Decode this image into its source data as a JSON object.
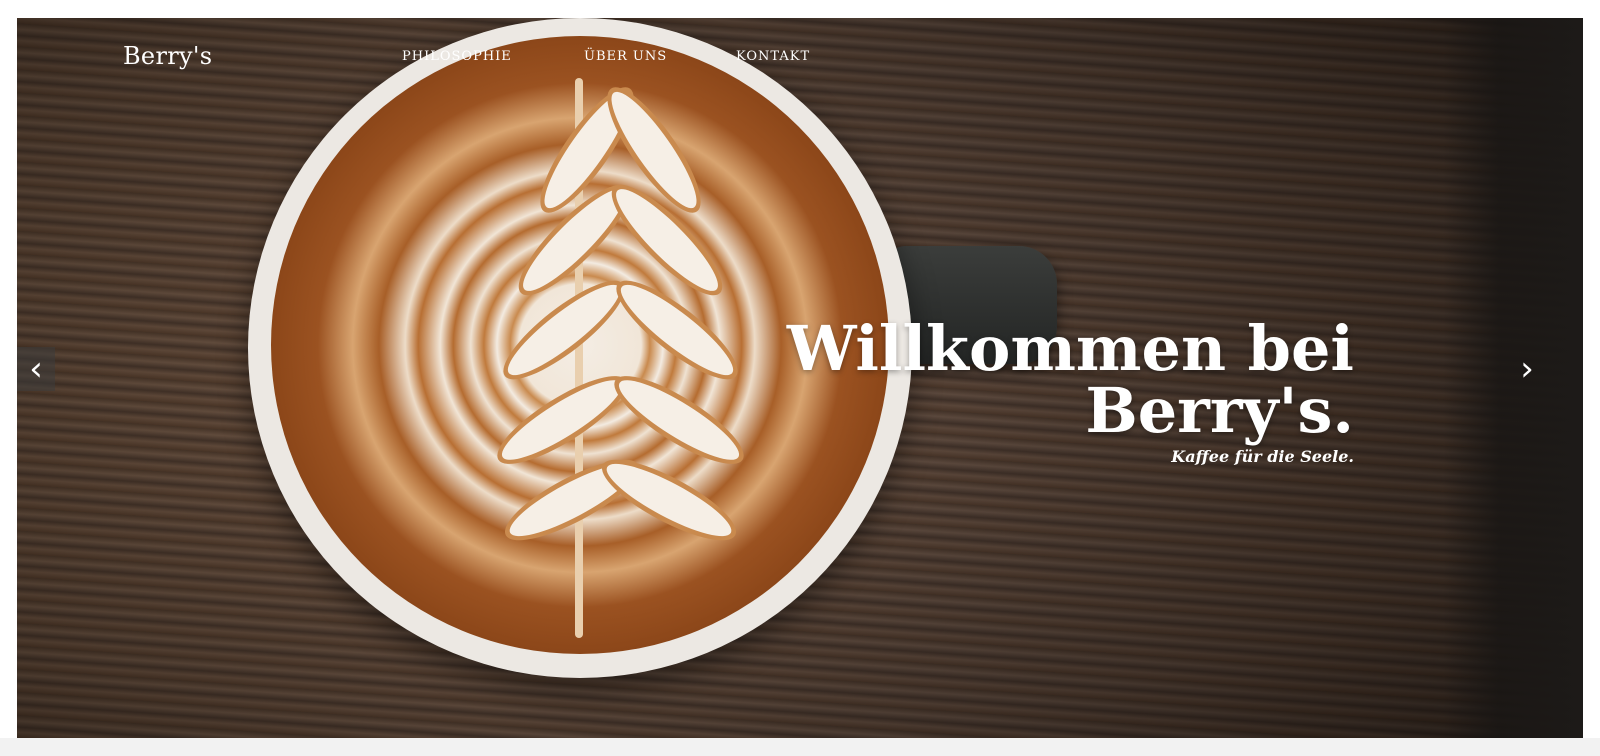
{
  "brand": {
    "name": "Berry's"
  },
  "nav": {
    "items": [
      {
        "label": "PHILOSOPHIE"
      },
      {
        "label": "ÜBER UNS"
      },
      {
        "label": "KONTAKT"
      }
    ]
  },
  "hero": {
    "headline_line1": "Willkommen bei",
    "headline_line2": "Berry's.",
    "tagline": "Kaffee für die Seele.",
    "prev_icon": "‹",
    "next_icon": "›"
  },
  "colors": {
    "text": "#ffffff",
    "coffee": "#a85f28",
    "foam": "#f3ebe1",
    "table_wood": "#5b4636"
  }
}
